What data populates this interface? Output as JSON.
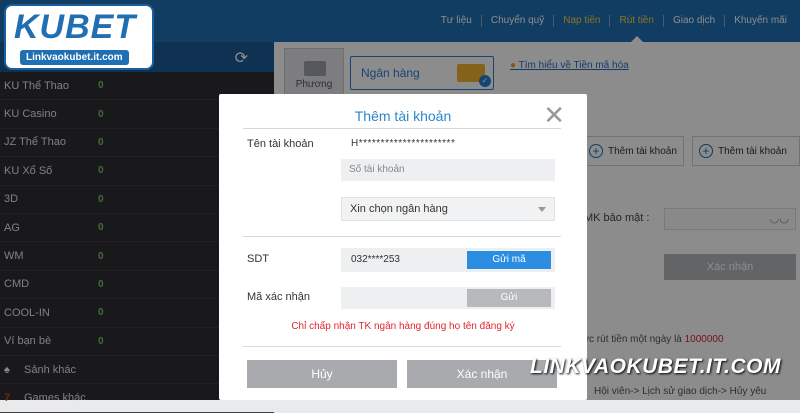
{
  "logo": {
    "main": "KUBET",
    "sub": "Linkvaokubet.it.com"
  },
  "nav": [
    "Tư liệu",
    "Chuyển quỹ",
    "Nạp tiền",
    "Rút tiền",
    "Giao dịch",
    "Khuyến mãi"
  ],
  "sidebar": {
    "items": [
      {
        "label": "KU Thể Thao",
        "value": "0"
      },
      {
        "label": "KU Casino",
        "value": "0"
      },
      {
        "label": "JZ Thể Thao",
        "value": "0"
      },
      {
        "label": "KU Xổ Số",
        "value": "0"
      },
      {
        "label": "3D",
        "value": "0"
      },
      {
        "label": "AG",
        "value": "0"
      },
      {
        "label": "WM",
        "value": "0"
      },
      {
        "label": "CMD",
        "value": "0"
      },
      {
        "label": "COOL-IN",
        "value": "0"
      },
      {
        "label": "Ví bạn bè",
        "value": "0"
      }
    ],
    "extra": [
      {
        "label": "Sảnh khác",
        "icon": "spade-icon"
      },
      {
        "label": "Games khác",
        "icon": "seven-icon"
      }
    ]
  },
  "main": {
    "pay_method": "Phương",
    "bank_tab": "Ngân hàng",
    "learn_link": "Tìm hiểu về Tiền mã hóa",
    "add_account_1": "Thêm tài khoản",
    "add_account_2": "Thêm tài khoản",
    "mk_label": "MK bảo mật :",
    "confirm": "Xác nhận",
    "note_prefix": "mức rút tiền một ngày là ",
    "note_amount": "1000000",
    "note2": "Hội viên-> Lịch sử giao dịch-> Hủy yêu"
  },
  "modal": {
    "title": "Thêm tài khoản",
    "account_name_label": "Tên tài khoản",
    "account_name_value": "H**********************",
    "account_number_placeholder": "Số tài khoản",
    "bank_select": "Xin chọn ngân hàng",
    "phone_label": "SDT",
    "phone_value": "032****253",
    "send_code": "Gửi mã",
    "verify_label": "Mã xác nhận",
    "resend": "Gửi",
    "warning": "Chỉ chấp nhận TK ngân hàng đúng họ tên đăng ký",
    "cancel": "Hủy",
    "confirm": "Xác nhận"
  },
  "watermark": "LINKVAOKUBET.IT.COM",
  "colors": {
    "primary": "#1f6fb2",
    "send_button": "#2b8ee2",
    "warning_red": "#e0262b",
    "nav_active": "#ffd24a"
  }
}
